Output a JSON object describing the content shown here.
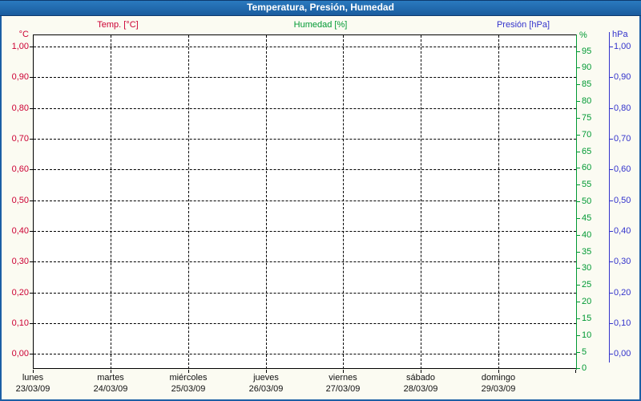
{
  "title_bar": {
    "title": "Temperatura, Presión, Humedad"
  },
  "legend": {
    "temp": "Temp. [°C]",
    "humidity": "Humedad [%]",
    "pressure": "Presión [hPa]"
  },
  "colors": {
    "temp": "#CC0033",
    "humidity": "#009933",
    "pressure": "#3333CC",
    "grid": "#000000",
    "frame": "#1C5FA5",
    "titlebar": "#1F6BB0",
    "plot_background": "#FFFFFF"
  },
  "axes": {
    "temp": {
      "header": "°C",
      "labels": [
        "1,00",
        "0,90",
        "0,80",
        "0,70",
        "0,60",
        "0,50",
        "0,40",
        "0,30",
        "0,20",
        "0,10",
        "0,00"
      ]
    },
    "humidity": {
      "header": "%",
      "labels": [
        "95",
        "90",
        "85",
        "80",
        "75",
        "70",
        "65",
        "60",
        "55",
        "50",
        "45",
        "40",
        "35",
        "30",
        "25",
        "20",
        "15",
        "10",
        "5",
        "0"
      ]
    },
    "pressure": {
      "header": "hPa",
      "labels": [
        "1,00",
        "0,90",
        "0,80",
        "0,70",
        "0,60",
        "0,50",
        "0,40",
        "0,30",
        "0,20",
        "0,10",
        "0,00"
      ]
    },
    "x": {
      "days": [
        {
          "name": "lunes",
          "date": "23/03/09"
        },
        {
          "name": "martes",
          "date": "24/03/09"
        },
        {
          "name": "miércoles",
          "date": "25/03/09"
        },
        {
          "name": "jueves",
          "date": "26/03/09"
        },
        {
          "name": "viernes",
          "date": "27/03/09"
        },
        {
          "name": "sábado",
          "date": "28/03/09"
        },
        {
          "name": "domingo",
          "date": "29/03/09"
        }
      ]
    }
  },
  "chart_data": {
    "type": "line",
    "title": "Temperatura, Presión, Humedad",
    "legend_position": "top",
    "x_axis": {
      "tick_labels": [
        "lunes 23/03/09",
        "martes 24/03/09",
        "miércoles 25/03/09",
        "jueves 26/03/09",
        "viernes 27/03/09",
        "sábado 28/03/09",
        "domingo 29/03/09"
      ],
      "span_days": 7,
      "gridlines": "dashed vertical line at each day boundary"
    },
    "y_axes": [
      {
        "label": "°C",
        "side": "left",
        "color": "#CC0033",
        "tick_values": [
          0.0,
          0.1,
          0.2,
          0.3,
          0.4,
          0.5,
          0.6,
          0.7,
          0.8,
          0.9,
          1.0
        ],
        "ylim": [
          -0.05,
          1.04
        ],
        "decimal_separator": "comma"
      },
      {
        "label": "%",
        "side": "right",
        "color": "#009933",
        "tick_values": [
          0,
          5,
          10,
          15,
          20,
          25,
          30,
          35,
          40,
          45,
          50,
          55,
          60,
          65,
          70,
          75,
          80,
          85,
          90,
          95
        ],
        "ylim": [
          0,
          100
        ]
      },
      {
        "label": "hPa",
        "side": "far-right",
        "color": "#3333CC",
        "tick_values": [
          0.0,
          0.1,
          0.2,
          0.3,
          0.4,
          0.5,
          0.6,
          0.7,
          0.8,
          0.9,
          1.0
        ],
        "ylim": [
          -0.05,
          1.04
        ],
        "decimal_separator": "comma"
      }
    ],
    "series": [
      {
        "name": "Temp. [°C]",
        "color": "#CC0033",
        "y_axis": "°C",
        "x": [],
        "values": []
      },
      {
        "name": "Humedad [%]",
        "color": "#009933",
        "y_axis": "%",
        "x": [],
        "values": []
      },
      {
        "name": "Presión [hPa]",
        "color": "#3333CC",
        "y_axis": "hPa",
        "x": [],
        "values": []
      }
    ],
    "grid": "black dashed horizontal gridlines every 0.10 (temp/pressure scale); dashed vertical gridlines at day boundaries",
    "note": "Plot area is empty — no data points are drawn for any of the three series."
  }
}
